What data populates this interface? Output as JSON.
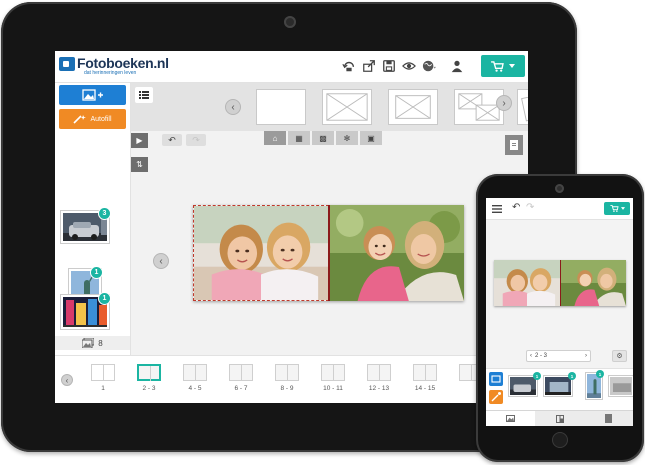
{
  "brand": {
    "name": "Fotoboeken.nl",
    "tagline": "dat herinneringen leven"
  },
  "colors": {
    "accent": "#1bb5a2",
    "photos_button": "#1e7fd4",
    "autofill_button": "#f08a24",
    "frame": "#151515"
  },
  "tablet": {
    "header_icons": [
      "undo-redo-icon",
      "share-icon",
      "save-icon",
      "preview-eye-icon",
      "language-globe-icon",
      "user-icon"
    ],
    "cart_icon": "shopping-cart-icon",
    "sidebar": {
      "autofill_label": "Autofill",
      "photos": [
        {
          "count": "3"
        },
        {
          "count": "1"
        },
        {
          "count": "1"
        }
      ],
      "photo_total": "8"
    },
    "pages": [
      {
        "label": "1"
      },
      {
        "label": "2 - 3"
      },
      {
        "label": "4 - 5"
      },
      {
        "label": "6 - 7"
      },
      {
        "label": "8 - 9"
      },
      {
        "label": "10 - 11"
      },
      {
        "label": "12 - 13"
      },
      {
        "label": "14 - 15"
      }
    ]
  },
  "phone": {
    "pager_label": "2 - 3",
    "photo_badges": [
      {
        "count": "1"
      },
      {
        "count": "1"
      },
      {
        "count": "1"
      }
    ]
  }
}
